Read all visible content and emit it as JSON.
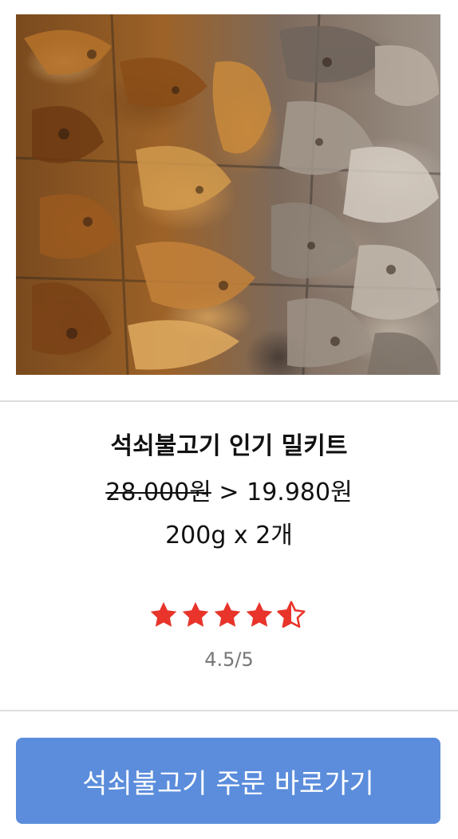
{
  "product": {
    "image_alt": "",
    "name": "석쇠불고기 인기 밀키트",
    "original_price": "28.000원",
    "price_separator": ">",
    "sale_price": "19.980원",
    "quantity": "200g x 2개"
  },
  "rating": {
    "text": "4.5/5",
    "value": 4.5,
    "max": 5,
    "star_color": "#e8342a",
    "star_icon": "star-icon"
  },
  "cta": {
    "label": "석쇠불고기 주문 바로가기",
    "color": "#5b8ddc"
  }
}
